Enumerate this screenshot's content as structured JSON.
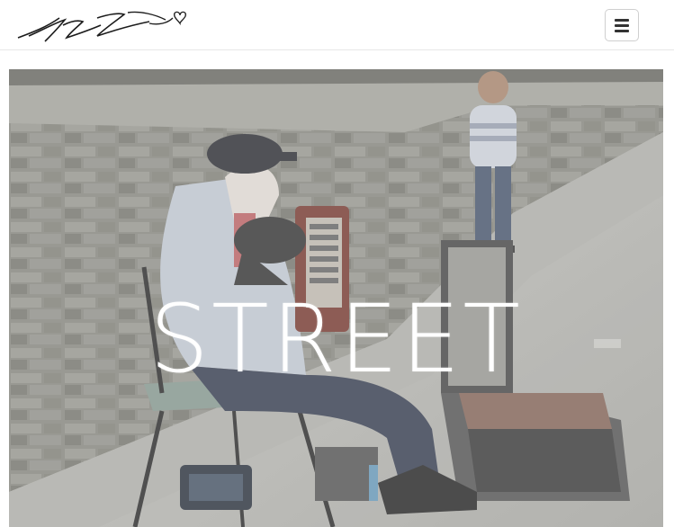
{
  "navbar": {
    "logo_name": "signature-logo",
    "menu_icon": "hamburger-icon"
  },
  "hero": {
    "title": "STREET",
    "overlay_color": "#ffffff",
    "image_description_icon": "street-musician-photo"
  },
  "colors": {
    "navbar_bg": "#ffffff",
    "navbar_border": "#e7e7e7",
    "menu_icon": "#333333",
    "title_text": "#ffffff"
  }
}
